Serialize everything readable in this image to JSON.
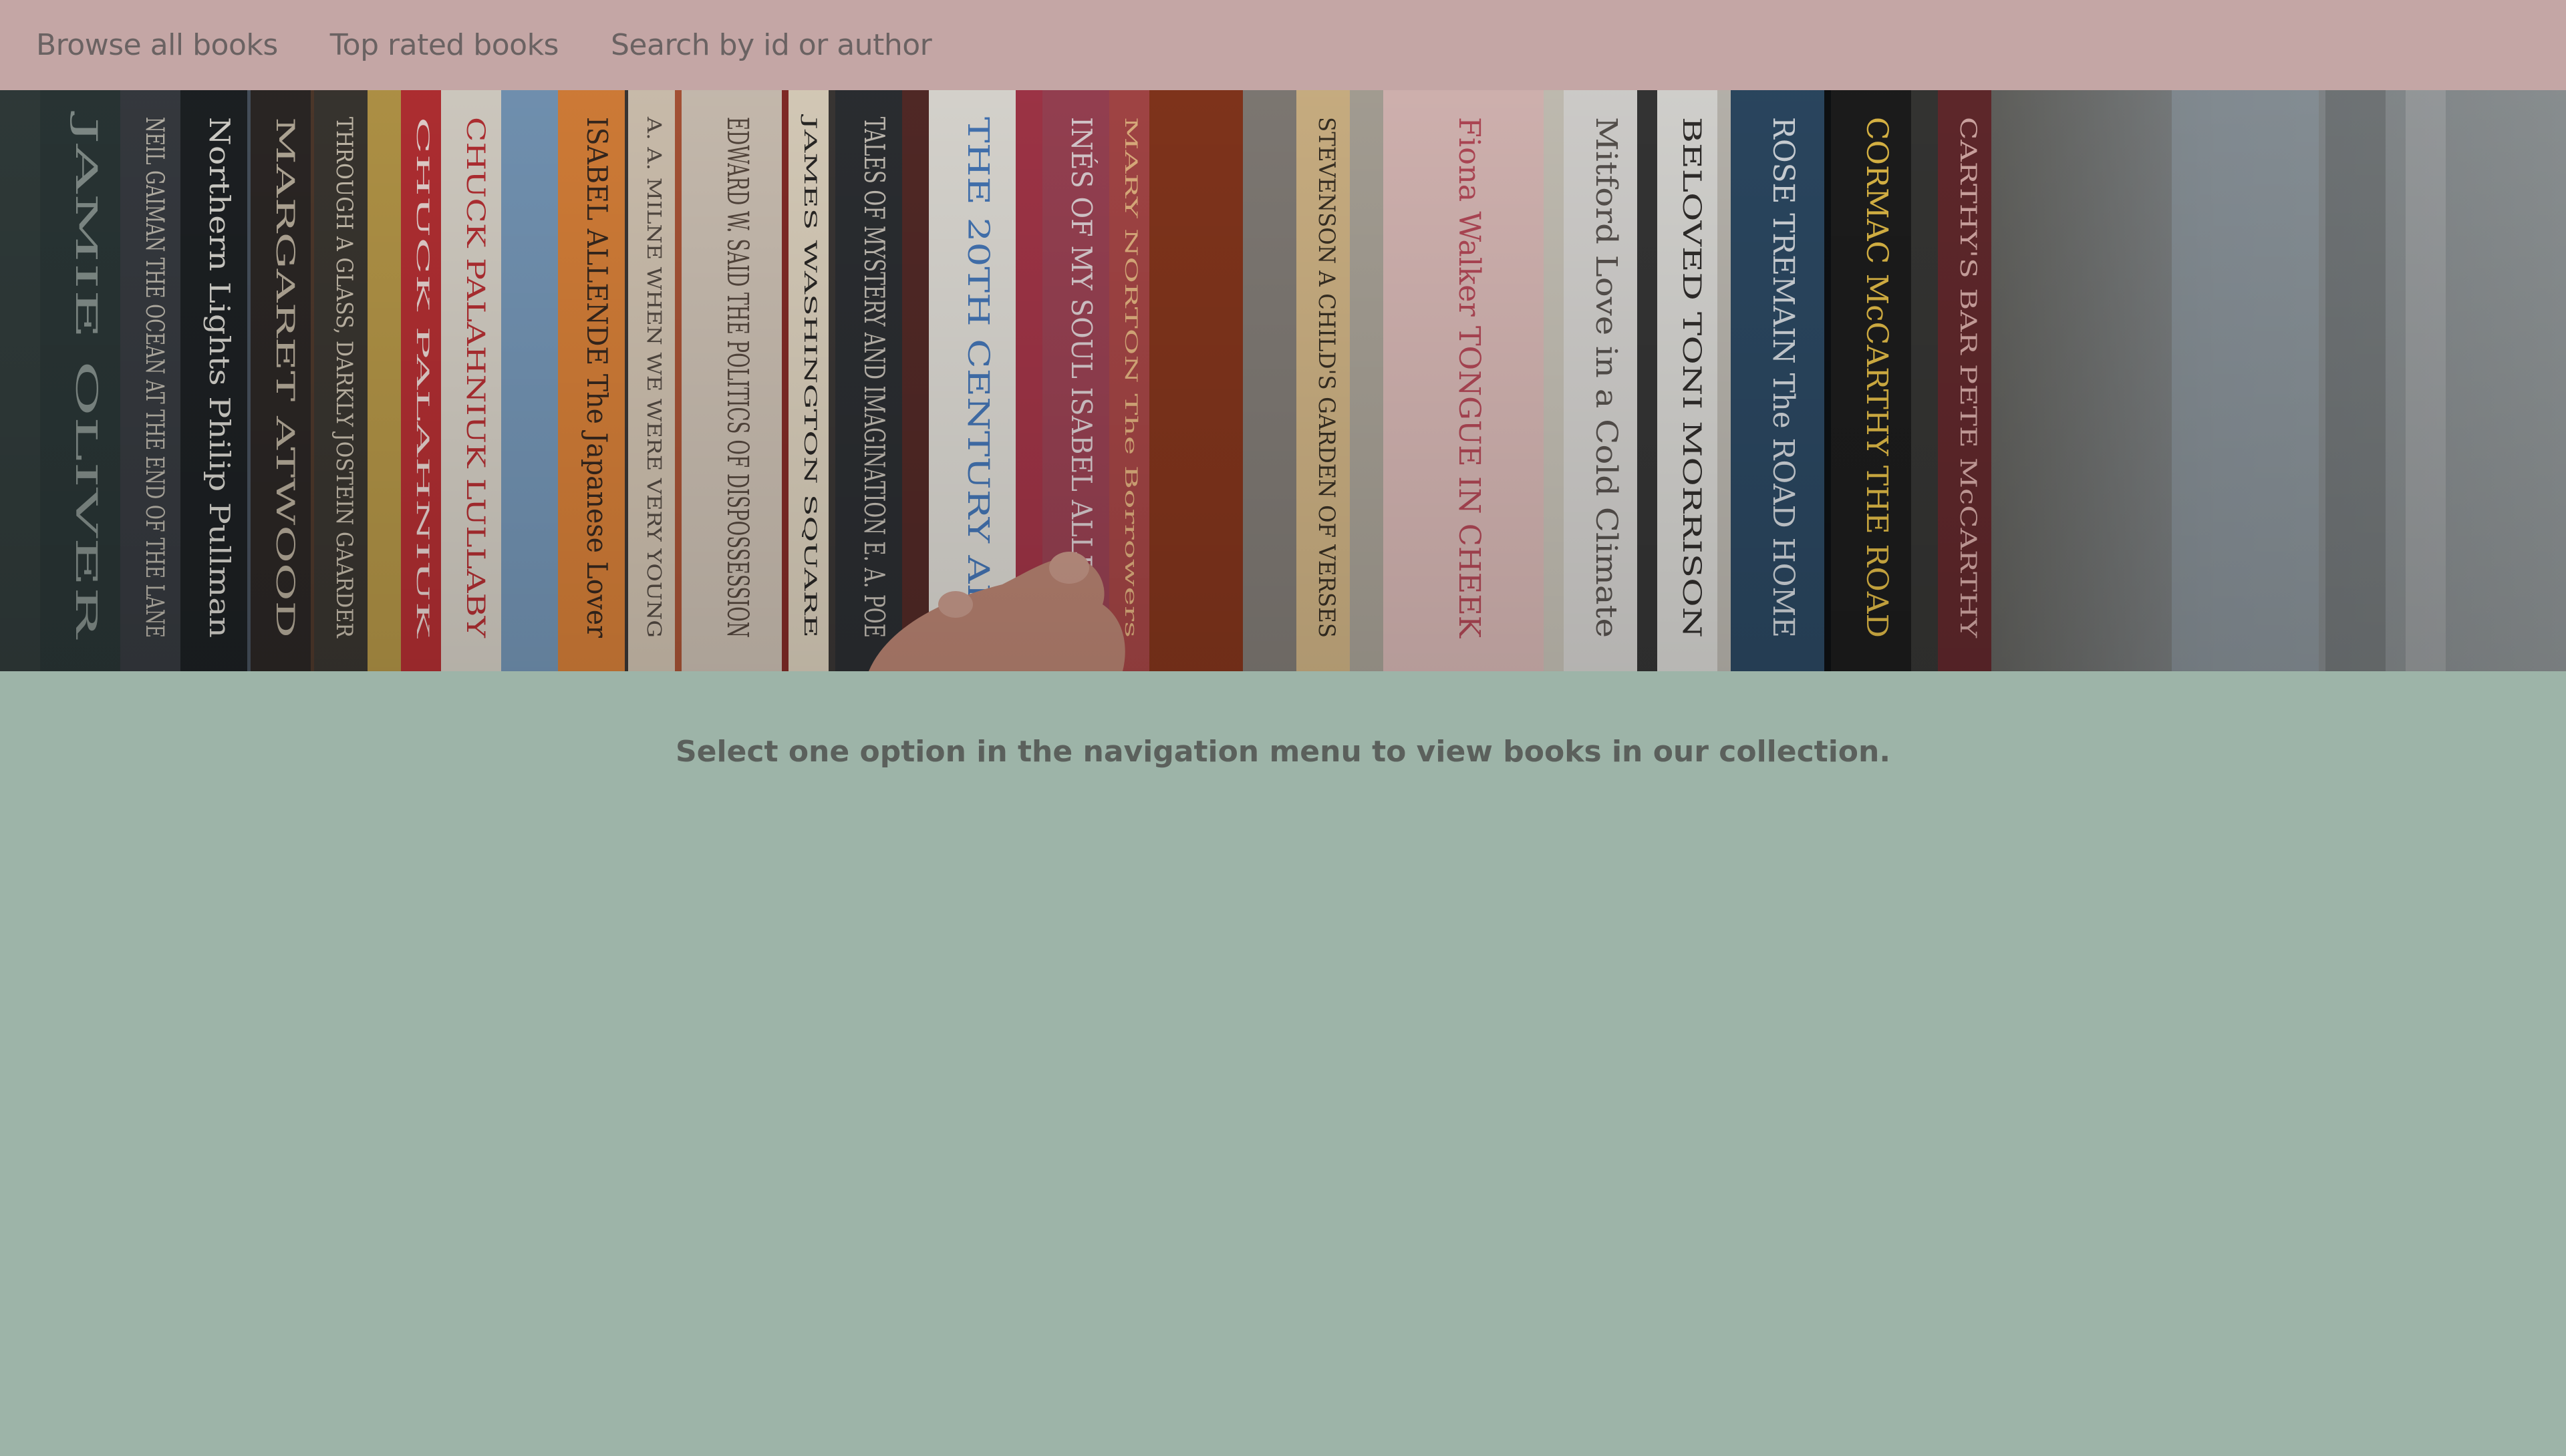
{
  "nav": {
    "items": [
      {
        "label": "Browse all books"
      },
      {
        "label": "Top rated books"
      },
      {
        "label": "Search by id or author"
      }
    ]
  },
  "banner": {
    "image_subject": "bookshelf-photo",
    "spines": [
      "JAMIE OLIVER",
      "NEIL GAIMAN THE OCEAN AT THE END OF THE LANE",
      "Northern Lights Philip Pullman",
      "MARGARET ATWOOD",
      "THROUGH A GLASS, DARKLY JOSTEIN GAARDER",
      "CHUCK PALAHNIUK",
      "CHUCK PALAHNIUK LULLABY",
      "ISABEL ALLENDE The Japanese Lover",
      "A. A. MILNE WHEN WE WERE VERY YOUNG",
      "EDWARD W. SAID THE POLITICS OF DISPOSSESSION",
      "JAMES WASHINGTON SQUARE",
      "TALES OF MYSTERY AND IMAGINATION E. A. POE",
      "THE 20TH CENTURY ART",
      "INÉS OF MY SOUL ISABEL ALLENDE",
      "MARY NORTON The Borrowers",
      "STEVENSON A CHILD'S GARDEN OF VERSES",
      "Fiona Walker TONGUE IN CHEEK",
      "Mitford Love in a Cold Climate",
      "BELOVED TONI MORRISON",
      "ROSE TREMAIN The ROAD HOME",
      "CORMAC McCARTHY THE ROAD",
      "CARTHY'S BAR PETE McCARTHY"
    ]
  },
  "main": {
    "message": "Select one option in the navigation menu to view books in our collection."
  },
  "colors": {
    "navbar_bg": "#c4a6a5",
    "page_bg": "#9db4a8",
    "nav_text": "#6a6262",
    "message_text": "#5b605c"
  }
}
